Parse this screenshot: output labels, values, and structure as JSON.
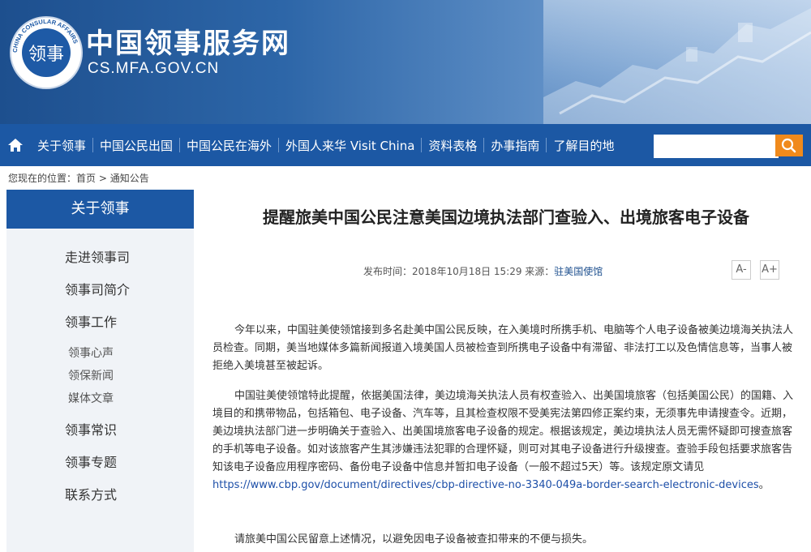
{
  "header": {
    "site_title": "中国领事服务网",
    "site_url": "CS.MFA.GOV.CN",
    "seal_char": "领事",
    "seal_ring_text": "CHINA CONSULAR AFFAIRS"
  },
  "nav": {
    "items": [
      "关于领事",
      "中国公民出国",
      "中国公民在海外",
      "外国人来华 Visit China",
      "资料表格",
      "办事指南",
      "了解目的地"
    ],
    "search_placeholder": ""
  },
  "breadcrumb": {
    "prefix": "您现在的位置：",
    "home": "首页",
    "sep": ">",
    "current": "通知公告"
  },
  "sidebar": {
    "title": "关于领事",
    "items": [
      {
        "label": "走进领事司",
        "level": 1
      },
      {
        "label": "领事司简介",
        "level": 1
      },
      {
        "label": "领事工作",
        "level": 1
      },
      {
        "label": "领事心声",
        "level": 2
      },
      {
        "label": "领保新闻",
        "level": 2
      },
      {
        "label": "媒体文章",
        "level": 2
      },
      {
        "label": "领事常识",
        "level": 1
      },
      {
        "label": "领事专题",
        "level": 1
      },
      {
        "label": "联系方式",
        "level": 1
      }
    ]
  },
  "article": {
    "title": "提醒旅美中国公民注意美国边境执法部门查验入、出境旅客电子设备",
    "meta_label": "发布时间：2018年10月18日 15:29 来源：",
    "source": "驻美国使馆",
    "font_smaller": "A-",
    "font_larger": "A+",
    "p1": "今年以来，中国驻美使领馆接到多名赴美中国公民反映，在入美境时所携手机、电脑等个人电子设备被美边境海关执法人员检查。同期，美当地媒体多篇新闻报道入境美国人员被检查到所携电子设备中有滞留、非法打工以及色情信息等，当事人被拒绝入美境甚至被起诉。",
    "p2_text": "中国驻美使领馆特此提醒，依据美国法律，美边境海关执法人员有权查验入、出美国境旅客（包括美国公民）的国籍、入境目的和携带物品，包括箱包、电子设备、汽车等，且其检查权限不受美宪法第四修正案约束，无须事先申请搜查令。近期，美边境执法部门进一步明确关于查验入、出美国境旅客电子设备的规定。根据该规定，美边境执法人员无需怀疑即可搜查旅客的手机等电子设备。如对该旅客产生其涉嫌违法犯罪的合理怀疑，则可对其电子设备进行升级搜查。查验手段包括要求旅客告知该电子设备应用程序密码、备份电子设备中信息并暂扣电子设备（一般不超过5天）等。该规定原文请见 ",
    "p2_link": "https://www.cbp.gov/document/directives/cbp-directive-no-3340-049a-border-search-electronic-devices",
    "p2_end": "。",
    "p3": "请旅美中国公民留意上述情况，以避免因电子设备被查扣带来的不便与损失。"
  },
  "colors": {
    "nav_bg": "#1c58a4",
    "search_btn": "#f08a1c",
    "link": "#1d4fa8"
  }
}
